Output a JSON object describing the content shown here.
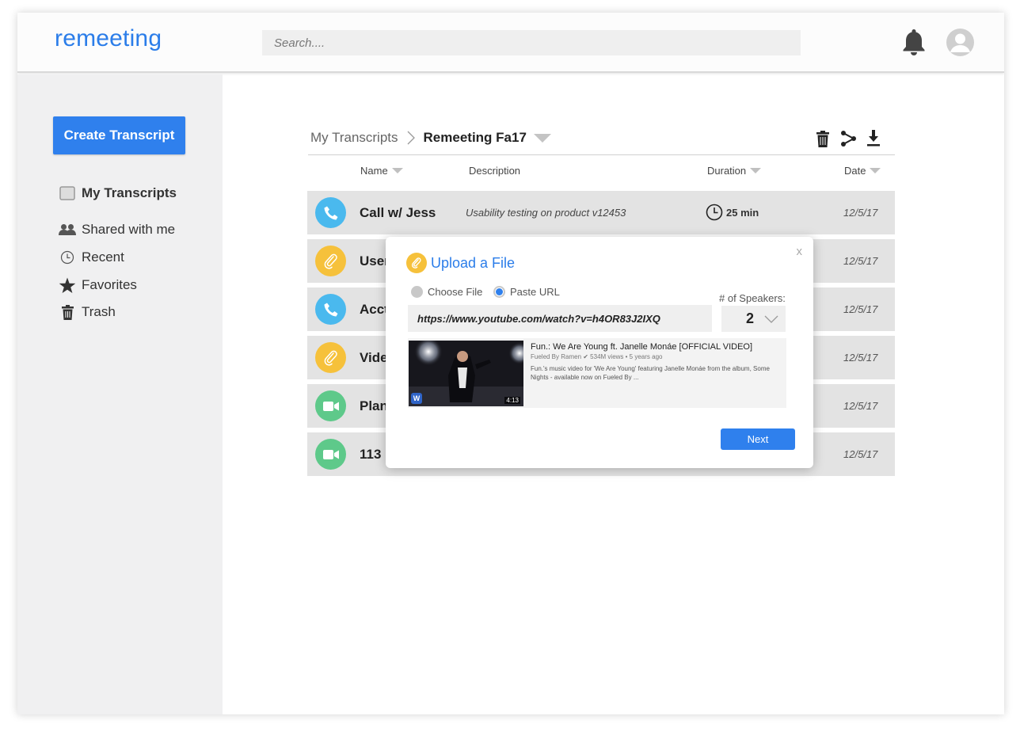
{
  "app": {
    "name": "remeeting"
  },
  "search": {
    "placeholder": "Search...."
  },
  "icons": {
    "bell": "bell-icon",
    "avatar": "user-avatar-icon"
  },
  "sidebar": {
    "create_label": "Create Transcript",
    "items": [
      {
        "label": "My Transcripts",
        "icon": "document-icon",
        "active": true
      },
      {
        "label": "Shared with me",
        "icon": "people-icon"
      },
      {
        "label": "Recent",
        "icon": "clock-icon"
      },
      {
        "label": "Favorites",
        "icon": "star-icon"
      },
      {
        "label": "Trash",
        "icon": "trash-icon"
      }
    ]
  },
  "breadcrumb": {
    "root": "My Transcripts",
    "current": "Remeeting Fa17"
  },
  "toolbar": {
    "icons": [
      "trash-icon",
      "share-icon",
      "download-icon"
    ]
  },
  "table": {
    "columns": {
      "name": "Name",
      "description": "Description",
      "duration": "Duration",
      "date": "Date"
    },
    "rows": [
      {
        "name": "Call w/ Jess",
        "description": "Usability testing on product v12453",
        "duration": "25 min",
        "date": "12/5/17",
        "type": "phone",
        "color": "#4ab9ee"
      },
      {
        "name": "User",
        "date": "12/5/17",
        "type": "attachment",
        "color": "#f6c13b"
      },
      {
        "name": "Acct",
        "date": "12/5/17",
        "type": "phone",
        "color": "#4ab9ee"
      },
      {
        "name": "Vide",
        "date": "12/5/17",
        "type": "attachment",
        "color": "#f6c13b"
      },
      {
        "name": "Plan",
        "date": "12/5/17",
        "type": "video",
        "color": "#5ec98a"
      },
      {
        "name": "113",
        "date": "12/5/17",
        "type": "video",
        "color": "#5ec98a"
      }
    ]
  },
  "modal": {
    "title": "Upload a File",
    "close": "x",
    "option_file": "Choose File",
    "option_url": "Paste URL",
    "selected_option": "Paste URL",
    "url_value": "https://www.youtube.com/watch?v=h4OR83J2IXQ",
    "speakers_label": "# of Speakers:",
    "speakers_value": "2",
    "preview": {
      "title": "Fun.: We Are Young ft. Janelle Monáe [OFFICIAL VIDEO]",
      "meta": "Fueled By Ramen ✔ 534M views • 5 years ago",
      "description": "Fun.'s music video for 'We Are Young' featuring Janelle Monáe from the album, Some Nights - available now on Fueled By ...",
      "duration": "4:13",
      "badge": "W"
    },
    "next_label": "Next"
  },
  "colors": {
    "accent": "#2f80ed",
    "logo": "#2b7de9",
    "phone": "#4ab9ee",
    "attachment": "#f6c13b",
    "video": "#5ec98a"
  }
}
